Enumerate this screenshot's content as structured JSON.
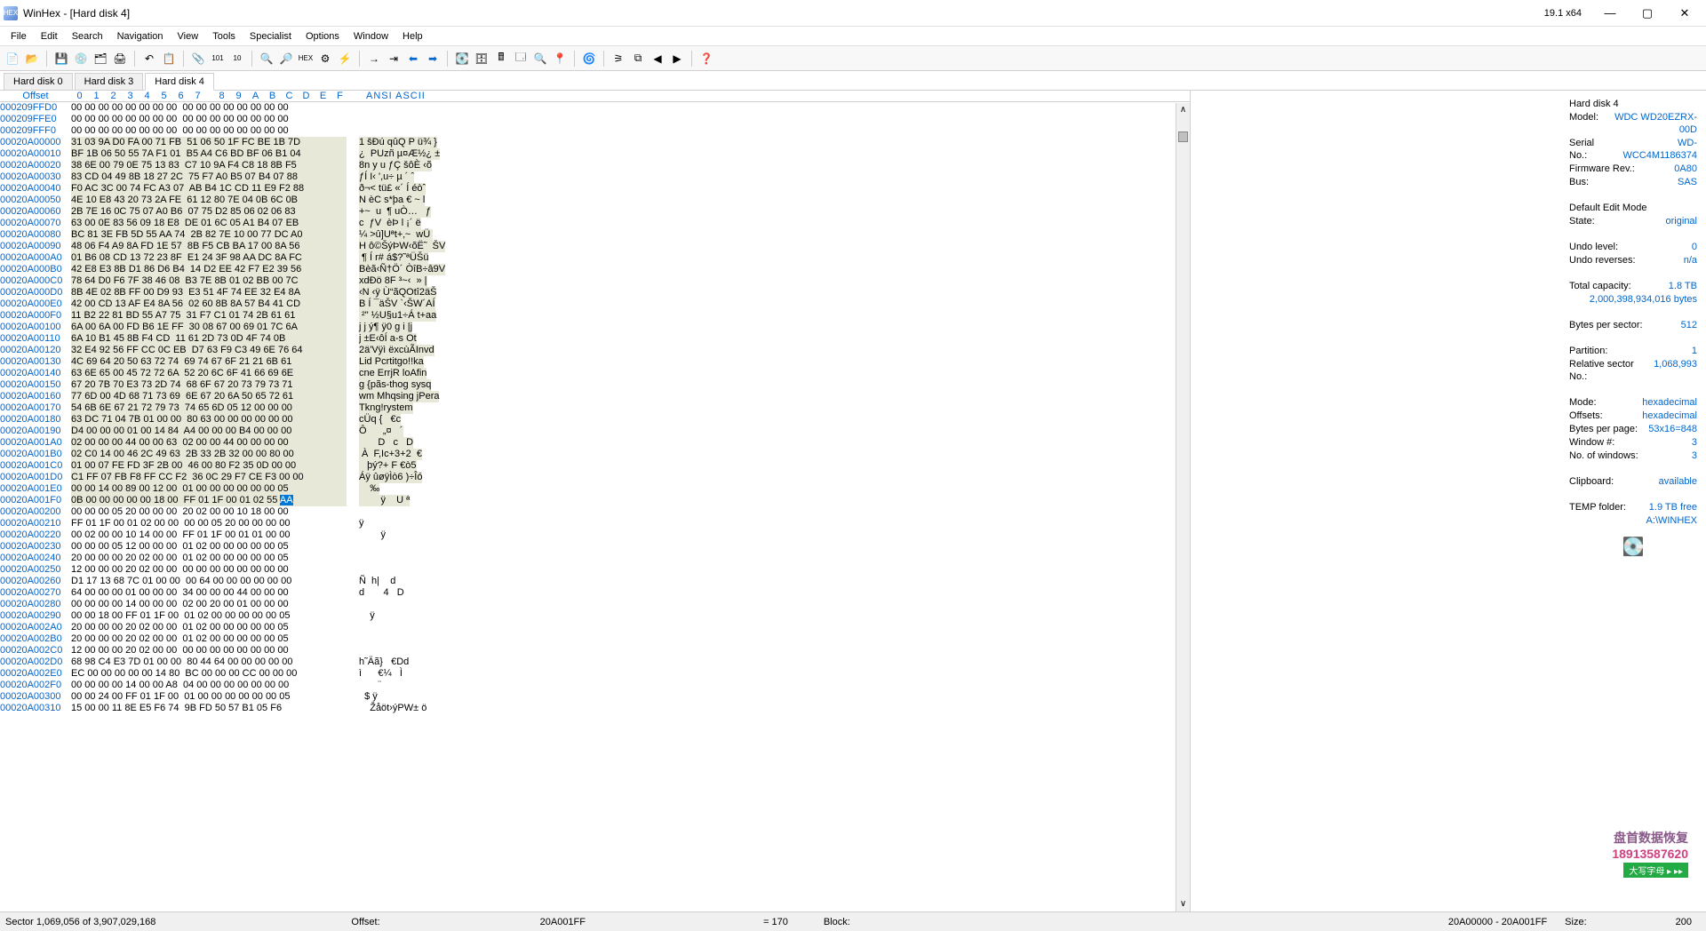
{
  "app": {
    "title": "WinHex - [Hard disk 4]",
    "version": "19.1 x64"
  },
  "menu": [
    "File",
    "Edit",
    "Search",
    "Navigation",
    "View",
    "Tools",
    "Specialist",
    "Options",
    "Window",
    "Help"
  ],
  "tabs": [
    {
      "label": "Hard disk 0",
      "active": false
    },
    {
      "label": "Hard disk 3",
      "active": false
    },
    {
      "label": "Hard disk 4",
      "active": true
    }
  ],
  "hex_header": {
    "offset_label": "Offset",
    "cols": [
      "0",
      "1",
      "2",
      "3",
      "4",
      "5",
      "6",
      "7",
      "8",
      "9",
      "A",
      "B",
      "C",
      "D",
      "E",
      "F"
    ],
    "ascii_label": "ANSI ASCII"
  },
  "hex_rows": [
    {
      "off": "000209FFD0",
      "b": "00 00 00 00 00 00 00 00  00 00 00 00 00 00 00 00",
      "a": "                ",
      "hl": false
    },
    {
      "off": "000209FFE0",
      "b": "00 00 00 00 00 00 00 00  00 00 00 00 00 00 00 00",
      "a": "                ",
      "hl": false
    },
    {
      "off": "000209FFF0",
      "b": "00 00 00 00 00 00 00 00  00 00 00 00 00 00 00 00",
      "a": "                ",
      "hl": false
    },
    {
      "off": "00020A00000",
      "b": "31 03 9A D0 FA 00 71 FB  51 06 50 1F FC BE 1B 7D",
      "a": "1 šÐú qûQ P ü¾ }",
      "hl": true
    },
    {
      "off": "00020A00010",
      "b": "BF 1B 06 50 55 7A F1 01  B5 A4 C6 BD BF 06 B1 04",
      "a": "¿  PUzñ µ¤Æ½¿ ±",
      "hl": true
    },
    {
      "off": "00020A00020",
      "b": "38 6E 00 79 0E 75 13 83  C7 10 9A F4 C8 18 8B F5",
      "a": "8n y u ƒÇ šôÈ ‹õ",
      "hl": true
    },
    {
      "off": "00020A00030",
      "b": "83 CD 04 49 8B 18 27 2C  75 F7 A0 B5 07 B4 07 88",
      "a": "ƒÍ I‹ ',u÷ µ ´ ˆ",
      "hl": true
    },
    {
      "off": "00020A00040",
      "b": "F0 AC 3C 00 74 FC A3 07  AB B4 1C CD 11 E9 F2 88",
      "a": "ð¬< tü£ «´ Í éòˆ",
      "hl": true
    },
    {
      "off": "00020A00050",
      "b": "4E 10 E8 43 20 73 2A FE  61 12 80 7E 04 0B 6C 0B",
      "a": "N èC s*þa € ~ l",
      "hl": true
    },
    {
      "off": "00020A00060",
      "b": "2B 7E 16 0C 75 07 A0 B6  07 75 D2 85 06 02 06 83",
      "a": "+~  u  ¶ uÒ…   ƒ",
      "hl": true
    },
    {
      "off": "00020A00070",
      "b": "63 00 0E 83 56 09 18 E8  DE 01 6C 05 A1 B4 07 EB",
      "a": "c  ƒV  èÞ l ¡´ ë",
      "hl": true
    },
    {
      "off": "00020A00080",
      "b": "BC 81 3E FB 5D 55 AA 74  2B 82 7E 10 00 77 DC A0",
      "a": "¼ >û]Uªt+‚~  wÜ ",
      "hl": true
    },
    {
      "off": "00020A00090",
      "b": "48 06 F4 A9 8A FD 1E 57  8B F5 CB BA 17 00 8A 56",
      "a": "H ô©ŠýÞW‹õË˜  ŠV",
      "hl": true
    },
    {
      "off": "00020A000A0",
      "b": "01 B6 08 CD 13 72 23 8F  E1 24 3F 98 AA DC 8A FC",
      "a": " ¶ Í r# á$?˜ªÜŠü",
      "hl": true
    },
    {
      "off": "00020A000B0",
      "b": "42 E8 E3 8B D1 86 D6 B4  14 D2 EE 42 F7 E2 39 56",
      "a": "Bèã‹Ñ†Ö´ ÒîB÷â9V",
      "hl": true
    },
    {
      "off": "00020A000C0",
      "b": "78 64 D0 F6 7F 38 46 08  B3 7E 8B 01 02 BB 00 7C",
      "a": "xdÐö 8F ³~‹  » |",
      "hl": true
    },
    {
      "off": "00020A000D0",
      "b": "8B 4E 02 8B FF 00 D9 93  E3 51 4F 74 EE 32 E4 8A",
      "a": "‹N ‹ÿ Ù“ãQOtî2äŠ",
      "hl": true
    },
    {
      "off": "00020A000E0",
      "b": "42 00 CD 13 AF E4 8A 56  02 60 8B 8A 57 B4 41 CD",
      "a": "B Í ¯äŠV `‹ŠW´AÍ",
      "hl": true
    },
    {
      "off": "00020A000F0",
      "b": "11 B2 22 81 BD 55 A7 75  31 F7 C1 01 74 2B 61 61",
      "a": " ²\" ½U§u1÷Á t+aa",
      "hl": true
    },
    {
      "off": "00020A00100",
      "b": "6A 00 6A 00 FD B6 1E FF  30 08 67 00 69 01 7C 6A",
      "a": "j j ý¶ ÿ0 g i |j",
      "hl": true
    },
    {
      "off": "00020A00110",
      "b": "6A 10 B1 45 8B F4 CD  11 61 2D 73 0D 4F 74 0B",
      "a": "j ±E‹ôÍ a-s Ot",
      "hl": true
    },
    {
      "off": "00020A00120",
      "b": "32 E4 92 56 FF CC 0C EB  D7 63 F9 C3 49 6E 76 64",
      "a": "2ä'Vÿì ëxcùÃInvd",
      "hl": true
    },
    {
      "off": "00020A00130",
      "b": "4C 69 64 20 50 63 72 74  69 74 67 6F 21 21 6B 61",
      "a": "Lid Pcrtitgo!!ka",
      "hl": true
    },
    {
      "off": "00020A00140",
      "b": "63 6E 65 00 45 72 72 6A  52 20 6C 6F 41 66 69 6E",
      "a": "cne ErrjR loAfin",
      "hl": true
    },
    {
      "off": "00020A00150",
      "b": "67 20 7B 70 E3 73 2D 74  68 6F 67 20 73 79 73 71",
      "a": "g {pãs-thog sysq",
      "hl": true
    },
    {
      "off": "00020A00160",
      "b": "77 6D 00 4D 68 71 73 69  6E 67 20 6A 50 65 72 61",
      "a": "wm Mhqsing jPera",
      "hl": true
    },
    {
      "off": "00020A00170",
      "b": "54 6B 6E 67 21 72 79 73  74 65 6D 05 12 00 00 00",
      "a": "Tkng!rystem",
      "hl": true
    },
    {
      "off": "00020A00180",
      "b": "63 DC 71 04 7B 01 00 00  80 63 00 00 00 00 00 00",
      "a": "cÜq {   €c",
      "hl": true
    },
    {
      "off": "00020A00190",
      "b": "D4 00 00 00 01 00 14 84  A4 00 00 00 B4 00 00 00",
      "a": "Ô      „¤   ´",
      "hl": true
    },
    {
      "off": "00020A001A0",
      "b": "02 00 00 00 44 00 00 63  02 00 00 44 00 00 00 00",
      "a": "       D   c   D",
      "hl": true
    },
    {
      "off": "00020A001B0",
      "b": "02 C0 14 00 46 2C 49 63  2B 33 2B 32 00 00 80 00",
      "a": " À  F,Ic+3+2  €",
      "hl": true
    },
    {
      "off": "00020A001C0",
      "b": "01 00 07 FE FD 3F 2B 00  46 00 80 F2 35 0D 00 00",
      "a": "   þý?+ F €ò5",
      "hl": true
    },
    {
      "off": "00020A001D0",
      "b": "C1 FF 07 FB F8 FF CC F2  36 0C 29 F7 CE F3 00 00",
      "a": "Áÿ ûøÿÌò6 )÷Îó",
      "hl": true
    },
    {
      "off": "00020A001E0",
      "b": "00 00 14 00 89 00 12 00  01 00 00 00 00 00 00 05",
      "a": "    ‰",
      "hl": true
    },
    {
      "off": "00020A001F0",
      "b": "0B 00 00 00 00 00 18 00  FF 01 1F 00 01 02 55 AA",
      "a": "        ÿ    U ª",
      "hl": true,
      "sel": true
    },
    {
      "off": "00020A00200",
      "b": "00 00 00 05 20 00 00 00  20 02 00 00 10 18 00 00",
      "a": "",
      "hl": false
    },
    {
      "off": "00020A00210",
      "b": "FF 01 1F 00 01 02 00 00  00 00 05 20 00 00 00 00",
      "a": "ÿ",
      "hl": false
    },
    {
      "off": "00020A00220",
      "b": "00 02 00 00 10 14 00 00  FF 01 1F 00 01 01 00 00",
      "a": "        ÿ",
      "hl": false
    },
    {
      "off": "00020A00230",
      "b": "00 00 00 05 12 00 00 00  01 02 00 00 00 00 00 05",
      "a": "",
      "hl": false
    },
    {
      "off": "00020A00240",
      "b": "20 00 00 00 20 02 00 00  01 02 00 00 00 00 00 05",
      "a": "",
      "hl": false
    },
    {
      "off": "00020A00250",
      "b": "12 00 00 00 20 02 00 00  00 00 00 00 00 00 00 00",
      "a": "",
      "hl": false
    },
    {
      "off": "00020A00260",
      "b": "D1 17 13 68 7C 01 00 00  00 64 00 00 00 00 00 00",
      "a": "Ñ  h|    d",
      "hl": false
    },
    {
      "off": "00020A00270",
      "b": "64 00 00 00 01 00 00 00  34 00 00 00 44 00 00 00",
      "a": "d       4   D",
      "hl": false
    },
    {
      "off": "00020A00280",
      "b": "00 00 00 00 14 00 00 00  02 00 20 00 01 00 00 00",
      "a": "",
      "hl": false
    },
    {
      "off": "00020A00290",
      "b": "00 00 18 00 FF 01 1F 00  01 02 00 00 00 00 00 05",
      "a": "    ÿ",
      "hl": false
    },
    {
      "off": "00020A002A0",
      "b": "20 00 00 00 20 02 00 00  01 02 00 00 00 00 00 05",
      "a": "",
      "hl": false
    },
    {
      "off": "00020A002B0",
      "b": "20 00 00 00 20 02 00 00  01 02 00 00 00 00 00 05",
      "a": "",
      "hl": false
    },
    {
      "off": "00020A002C0",
      "b": "12 00 00 00 20 02 00 00  00 00 00 00 00 00 00 00",
      "a": "",
      "hl": false
    },
    {
      "off": "00020A002D0",
      "b": "68 98 C4 E3 7D 01 00 00  80 44 64 00 00 00 00 00",
      "a": "h˜Äã}   €Dd",
      "hl": false
    },
    {
      "off": "00020A002E0",
      "b": "EC 00 00 00 00 00 14 80  BC 00 00 00 CC 00 00 00",
      "a": "ì      €¼   Ì",
      "hl": false
    },
    {
      "off": "00020A002F0",
      "b": "00 00 00 00 14 00 00 A8  04 00 00 00 00 00 00 00",
      "a": "       ¨",
      "hl": false
    },
    {
      "off": "00020A00300",
      "b": "00 00 24 00 FF 01 1F 00  01 00 00 00 00 00 00 05",
      "a": "  $ ÿ",
      "hl": false
    },
    {
      "off": "00020A00310",
      "b": "15 00 00 11 8E E5 F6 74  9B FD 50 57 B1 05 F6",
      "a": "    Žåöt›ýPW± ö",
      "hl": false
    }
  ],
  "info": {
    "device": "Hard disk 4",
    "model_lbl": "Model:",
    "model": "WDC WD20EZRX-00D",
    "serial_lbl": "Serial No.:",
    "serial": "WD-WCC4M1186374",
    "firmware_lbl": "Firmware Rev.:",
    "firmware": "0A80",
    "bus_lbl": "Bus:",
    "bus": "SAS",
    "editmode_lbl": "Default Edit Mode",
    "state_lbl": "State:",
    "state": "original",
    "undo_lbl": "Undo level:",
    "undo": "0",
    "undor_lbl": "Undo reverses:",
    "undor": "n/a",
    "totcap_lbl": "Total capacity:",
    "totcap": "1.8 TB",
    "totcap_bytes": "2,000,398,934,016 bytes",
    "bps_lbl": "Bytes per sector:",
    "bps": "512",
    "part_lbl": "Partition:",
    "part": "1",
    "relsec_lbl": "Relative sector No.:",
    "relsec": "1,068,993",
    "mode_lbl": "Mode:",
    "mode": "hexadecimal",
    "offsets_lbl": "Offsets:",
    "offsets": "hexadecimal",
    "bpp_lbl": "Bytes per page:",
    "bpp": "53x16=848",
    "win_lbl": "Window #:",
    "win": "3",
    "nwin_lbl": "No. of windows:",
    "nwin": "3",
    "clip_lbl": "Clipboard:",
    "clip": "available",
    "temp_lbl": "TEMP folder:",
    "temp": "1.9 TB free",
    "temp_path": "A:\\WINHEX"
  },
  "status": {
    "sector": "Sector 1,069,056 of 3,907,029,168",
    "offset_lbl": "Offset:",
    "offset": "20A001FF",
    "val_lbl": "= 170",
    "block_lbl": "Block:",
    "block": "20A00000 - 20A001FF",
    "size_lbl": "Size:",
    "size": "200"
  },
  "watermark": {
    "ch": "盘首数据恢复",
    "num": "18913587620",
    "ind": "大写字母 ▸ ▸▸"
  }
}
